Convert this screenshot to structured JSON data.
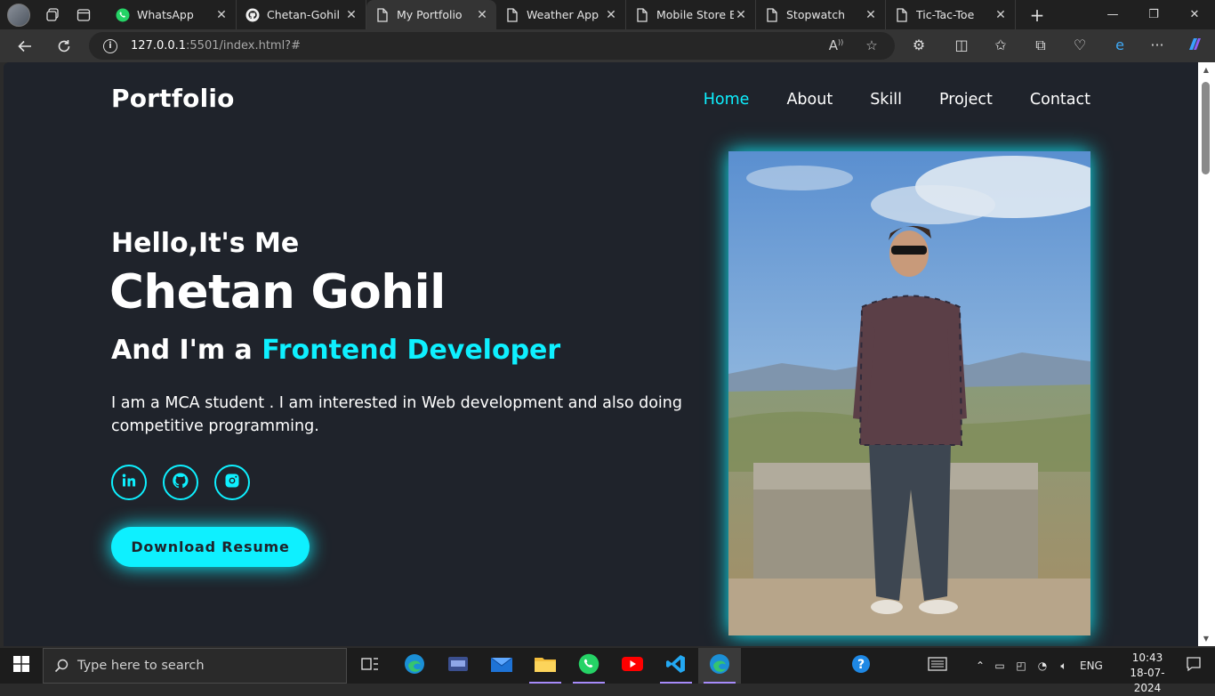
{
  "browser": {
    "tabs": [
      {
        "title": "WhatsApp",
        "icon": "whatsapp-icon",
        "active": false
      },
      {
        "title": "Chetan-Gohil (C",
        "icon": "github-icon",
        "active": false
      },
      {
        "title": "My Portfolio",
        "icon": "page-icon",
        "active": true
      },
      {
        "title": "Weather App",
        "icon": "page-icon",
        "active": false
      },
      {
        "title": "Mobile Store E",
        "icon": "page-icon",
        "active": false
      },
      {
        "title": "Stopwatch",
        "icon": "page-icon",
        "active": false
      },
      {
        "title": "Tic-Tac-Toe",
        "icon": "page-icon",
        "active": false
      }
    ],
    "url_host": "127.0.0.1",
    "url_path": ":5501/index.html?#"
  },
  "page": {
    "logo": "Portfolio",
    "nav": [
      {
        "label": "Home",
        "current": true
      },
      {
        "label": "About",
        "current": false
      },
      {
        "label": "Skill",
        "current": false
      },
      {
        "label": "Project",
        "current": false
      },
      {
        "label": "Contact",
        "current": false
      }
    ],
    "greeting": "Hello,It's Me",
    "name": "Chetan Gohil",
    "role_prefix": "And I'm a ",
    "role_highlight": "Frontend Developer",
    "bio": "I am a MCA student . I am interested in Web development and also doing competitive programming.",
    "socials": [
      "linkedin-icon",
      "github-icon",
      "instagram-icon"
    ],
    "resume_button": "Download Resume",
    "accent_color": "#0ef0ff",
    "background_color": "#1f232b"
  },
  "taskbar": {
    "search_placeholder": "Type here to search",
    "language": "ENG",
    "time": "10:43",
    "date": "18-07-2024"
  }
}
